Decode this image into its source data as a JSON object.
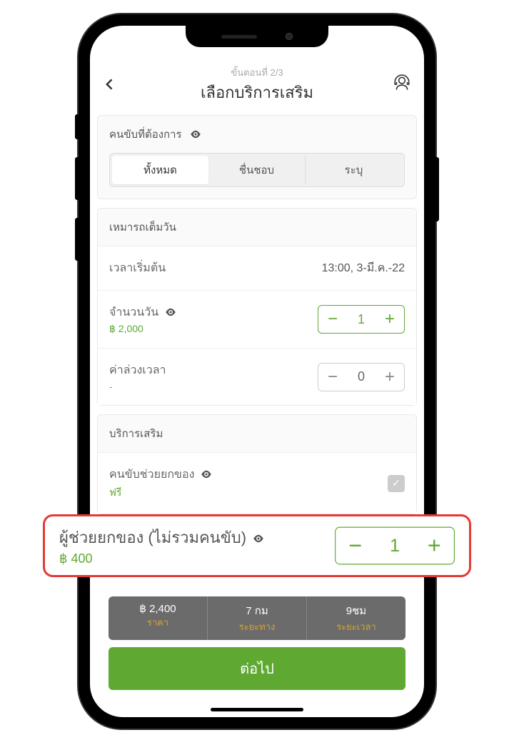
{
  "header": {
    "step": "ขั้นตอนที่ 2/3",
    "title": "เลือกบริการเสริม"
  },
  "driverPref": {
    "title": "คนขับที่ต้องการ",
    "tabs": [
      "ทั้งหมด",
      "ชื่นชอบ",
      "ระบุ"
    ],
    "activeIndex": 0
  },
  "fullDay": {
    "title": "เหมารถเต็มวัน",
    "startTime": {
      "label": "เวลาเริ่มต้น",
      "value": "13:00, 3-มี.ค.-22"
    },
    "days": {
      "label": "จำนวนวัน",
      "price": "฿ 2,000",
      "value": "1"
    },
    "overtime": {
      "label": "ค่าล่วงเวลา",
      "sub": "-",
      "value": "0"
    }
  },
  "addons": {
    "title": "บริการเสริม",
    "driverHelp": {
      "label": "คนขับช่วยยกของ",
      "price": "ฟรี",
      "checked": true
    }
  },
  "callout": {
    "label": "ผู้ช่วยยกของ (ไม่รวมคนขับ)",
    "price": "฿ 400",
    "value": "1"
  },
  "summary": {
    "price": {
      "value": "฿ 2,400",
      "label": "ราคา"
    },
    "distance": {
      "value": "7 กม",
      "label": "ระยะทาง"
    },
    "duration": {
      "value": "9ชม",
      "label": "ระยะเวลา"
    }
  },
  "cta": "ต่อไป"
}
